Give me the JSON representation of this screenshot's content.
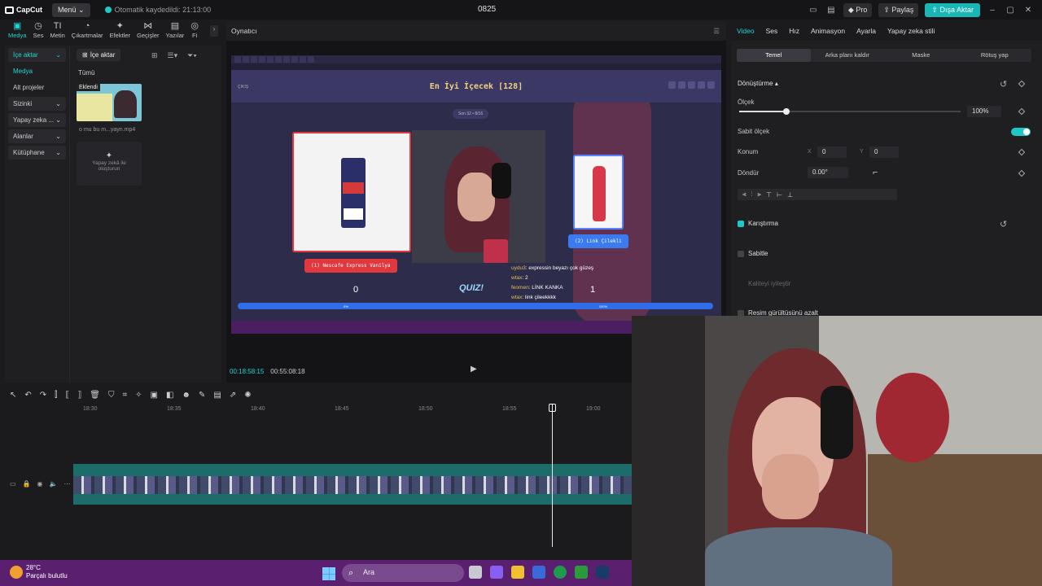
{
  "titlebar": {
    "app_name": "CapCut",
    "menu_label": "Menü",
    "autosave": "Otomatik kaydedildi: 21:13:00",
    "project_title": "0825",
    "pro_label": "Pro",
    "share_label": "Paylaş",
    "export_label": "Dışa Aktar"
  },
  "tool_tabs": [
    {
      "label": "Medya",
      "icon": "media-icon",
      "glyph": "▣"
    },
    {
      "label": "Ses",
      "icon": "audio-icon",
      "glyph": "◷"
    },
    {
      "label": "Metin",
      "icon": "text-icon",
      "glyph": "TI"
    },
    {
      "label": "Çıkartmalar",
      "icon": "sticker-icon",
      "glyph": "◔"
    },
    {
      "label": "Efektler",
      "icon": "effects-icon",
      "glyph": "✦"
    },
    {
      "label": "Geçişler",
      "icon": "transitions-icon",
      "glyph": "⋈"
    },
    {
      "label": "Yazılar",
      "icon": "captions-icon",
      "glyph": "▤"
    },
    {
      "label": "Fi",
      "icon": "filters-icon",
      "glyph": "◎"
    }
  ],
  "left_nav": [
    {
      "label": "İçe aktar",
      "dropdown": true,
      "active": true
    },
    {
      "label": "Medya",
      "dropdown": false,
      "active": true
    },
    {
      "label": "Alt projeler",
      "dropdown": false,
      "active": false
    },
    {
      "label": "Sizinki",
      "dropdown": true,
      "active": false
    },
    {
      "label": "Yapay zeka ...",
      "dropdown": true,
      "active": false
    },
    {
      "label": "Alanlar",
      "dropdown": true,
      "active": false
    },
    {
      "label": "Kütüphane",
      "dropdown": true,
      "active": false
    }
  ],
  "media": {
    "import_label": "İçe aktar",
    "all_label": "Tümü",
    "added_badge": "Eklendi",
    "clip_name": "o mu bu m...yayn.mp4",
    "ai_card_label": "Yapay zekâ ile oluşturun"
  },
  "player": {
    "title": "Oynatıcı",
    "time_current": "00:18:58:15",
    "time_total": "00:55:08:18",
    "canvas": {
      "back_label": "ÇIKIŞ",
      "quiz_title": "En İyi İçecek [128]",
      "round_label": "Son 32 • 8/16",
      "left_choice": "(1) Nescafe Express Vanilya",
      "right_choice": "(2) Link Çilekli",
      "left_score": "0",
      "right_score": "1",
      "left_pct": "0%",
      "right_pct": "100%",
      "quiz_logo": "QUIZ!",
      "chat": [
        {
          "user": "uydu3",
          "text": ": expressin beyazı çok güzeş"
        },
        {
          "user": "wtax",
          "text": ": 2"
        },
        {
          "user": "feomen",
          "text": ": LİNK KANKA"
        },
        {
          "user": "wtax",
          "text": ": link çileekkkk"
        }
      ]
    }
  },
  "right_tabs": [
    "Video",
    "Ses",
    "Hız",
    "Animasyon",
    "Ayarla",
    "Yapay zeka stili"
  ],
  "right_subtabs": [
    "Temel",
    "Arka planı kaldır",
    "Maske",
    "Rötuş yap"
  ],
  "properties": {
    "transform_label": "Dönüştürme",
    "scale_label": "Ölçek",
    "scale_value": "100%",
    "uniform_scale_label": "Sabit ölçek",
    "position_label": "Konum",
    "pos_x_label": "X",
    "pos_x": "0",
    "pos_y_label": "Y",
    "pos_y": "0",
    "rotate_label": "Döndür",
    "rotate_value": "0.00°",
    "blend_label": "Karıştırma",
    "stabilize_label": "Sabitle",
    "quality_label": "Kaliteyi iyileştir",
    "denoise_label": "Resim gürültüsünü azalt"
  },
  "timeline": {
    "ruler": [
      "18:30",
      "18:35",
      "18:40",
      "18:45",
      "18:50",
      "18:55",
      "19:00"
    ]
  },
  "taskbar": {
    "temp": "28°C",
    "weather": "Parçalı bulutlu",
    "search_label": "Ara"
  },
  "colors": {
    "accent": "#1ED6D4",
    "export_button": "#18B7B5",
    "taskbar": "#5B1F70"
  }
}
